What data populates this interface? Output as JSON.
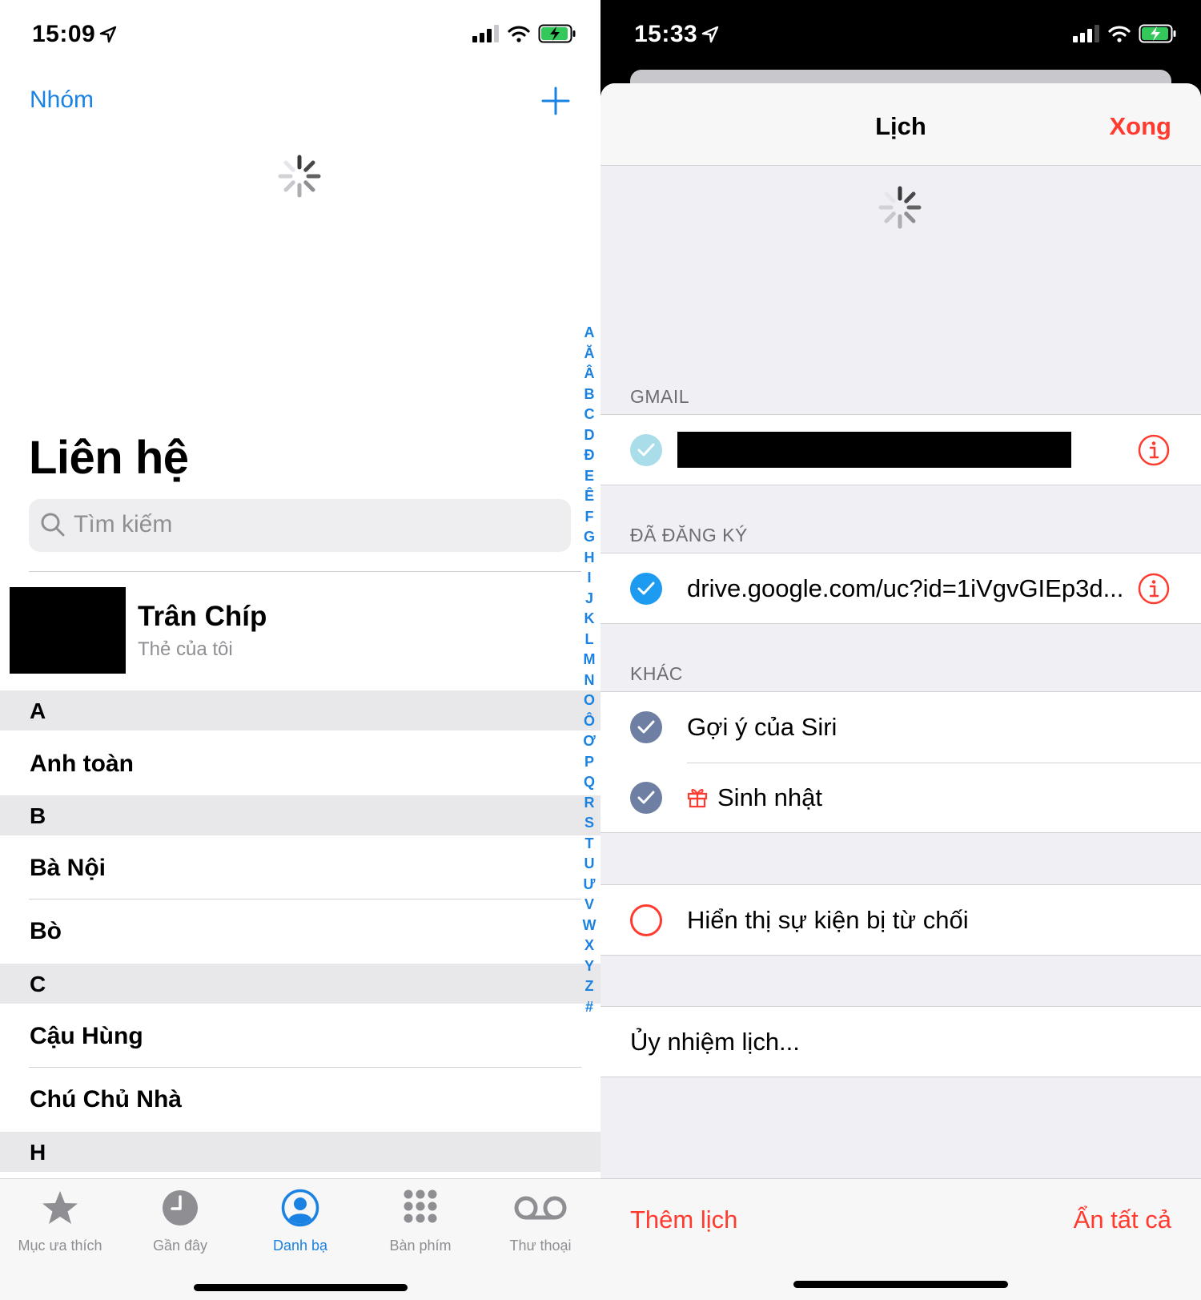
{
  "left": {
    "status": {
      "time": "15:09"
    },
    "nav": {
      "groups_label": "Nhóm"
    },
    "title": "Liên hệ",
    "search": {
      "placeholder": "Tìm kiếm"
    },
    "my_card": {
      "name": "Trân Chíp",
      "subtitle": "Thẻ của tôi"
    },
    "sections": [
      {
        "letter": "A",
        "rows": [
          "Anh toàn"
        ]
      },
      {
        "letter": "B",
        "rows": [
          "Bà Nội",
          "Bò"
        ]
      },
      {
        "letter": "C",
        "rows": [
          "Cậu Hùng",
          "Chú Chủ Nhà"
        ]
      },
      {
        "letter": "H",
        "rows": []
      }
    ],
    "index_letters": [
      "A",
      "Ă",
      "Â",
      "B",
      "C",
      "D",
      "Đ",
      "E",
      "Ê",
      "F",
      "G",
      "H",
      "I",
      "J",
      "K",
      "L",
      "M",
      "N",
      "O",
      "Ô",
      "Ơ",
      "P",
      "Q",
      "R",
      "S",
      "T",
      "U",
      "Ư",
      "V",
      "W",
      "X",
      "Y",
      "Z",
      "#"
    ],
    "tabs": [
      {
        "label": "Mục ưa thích",
        "icon": "star-icon"
      },
      {
        "label": "Gần đây",
        "icon": "clock-icon"
      },
      {
        "label": "Danh bạ",
        "icon": "person-circle-icon",
        "active": true
      },
      {
        "label": "Bàn phím",
        "icon": "keypad-icon"
      },
      {
        "label": "Thư thoại",
        "icon": "voicemail-icon"
      }
    ],
    "accent": "#1a82e2"
  },
  "right": {
    "status": {
      "time": "15:33"
    },
    "sheet": {
      "title": "Lịch",
      "done": "Xong"
    },
    "groups": [
      {
        "label": "GMAIL"
      },
      {
        "label": "ĐÃ ĐĂNG KÝ",
        "item": "drive.google.com/uc?id=1iVgvGIEp3d..."
      },
      {
        "label": "KHÁC",
        "items": [
          "Gợi ý của Siri",
          "Sinh nhật"
        ]
      }
    ],
    "show_declined": "Hiển thị sự kiện bị từ chối",
    "delegate": "Ủy nhiệm lịch...",
    "footer": {
      "add": "Thêm lịch",
      "hide_all": "Ẩn tất cả"
    },
    "accent": "#ff3b30"
  }
}
